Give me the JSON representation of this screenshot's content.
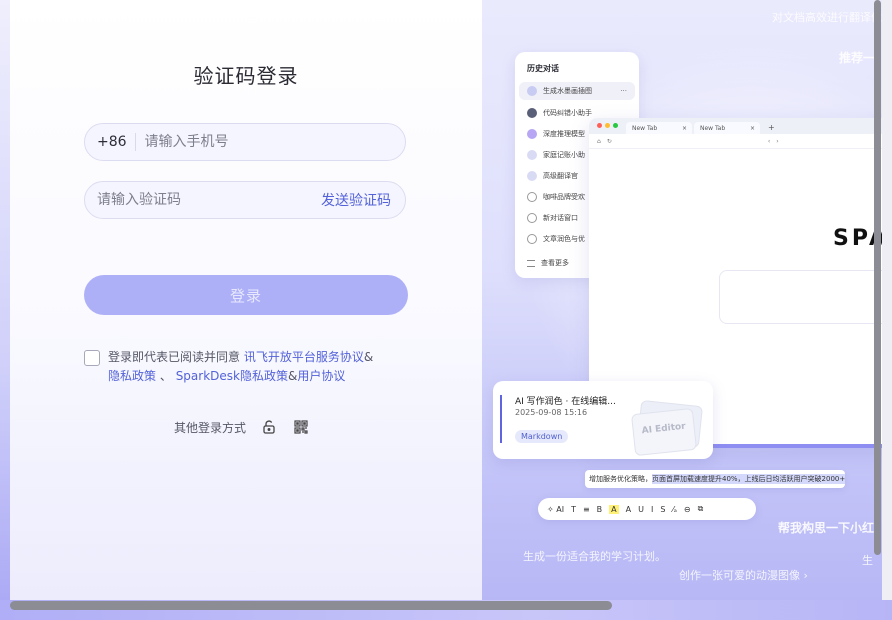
{
  "login": {
    "title": "验证码登录",
    "phone_prefix": "+86",
    "phone_placeholder": "请输入手机号",
    "code_placeholder": "请输入验证码",
    "send_code": "发送验证码",
    "submit": "登录",
    "agreement": {
      "prefix": "登录即代表已阅读并同意",
      "link1": "讯飞开放平台服务协议",
      "amp1": "&",
      "link2": "隐私政策",
      "sep": "、",
      "link3": "SparkDesk隐私政策",
      "amp2": "&",
      "link4": "用户协议"
    },
    "other_login": "其他登录方式",
    "other_icons": [
      "unlock-icon",
      "qrcode-icon"
    ]
  },
  "promo": {
    "floating": {
      "top_right": "对文档高效进行翻译优化",
      "top_right_2": "推荐一",
      "mid_right": "帮我构思一下小红",
      "bottom_left": "生成一份适合我的学习计划。",
      "bottom_mid": "创作一张可爱的动漫图像 ›",
      "bottom_right": "生"
    },
    "history": {
      "title": "历史对话",
      "items": [
        "生成水墨画插图",
        "代码纠错小助手",
        "深度推理模型",
        "家庭记账小助",
        "高级翻译官",
        "咖啡品牌受欢",
        "新对话窗口",
        "文章润色与优",
        "查看更多"
      ],
      "more": "···"
    },
    "browser": {
      "tab1": "New Tab",
      "tab2": "New Tab",
      "close": "×",
      "new_tab": "+",
      "logo": "SPARK"
    },
    "editor": {
      "title": "AI 写作润色 · 在线编辑...",
      "date": "2025-09-08  15:16",
      "tag": "Markdown",
      "stack_label": "AI Editor"
    },
    "selection": {
      "before": "增加服务优化策略，",
      "highlight": "页面首屏加载速度提升40%，上线后日均活跃用户突破2000+"
    },
    "toolbar": [
      "✧ AI",
      "T",
      "≡",
      "B",
      "A",
      "A",
      "U",
      "I",
      "S",
      "⁄ₐ",
      "⊖",
      "⧉"
    ]
  },
  "colors": {
    "accent": "#5362d8",
    "button": "#aeb0f7"
  }
}
